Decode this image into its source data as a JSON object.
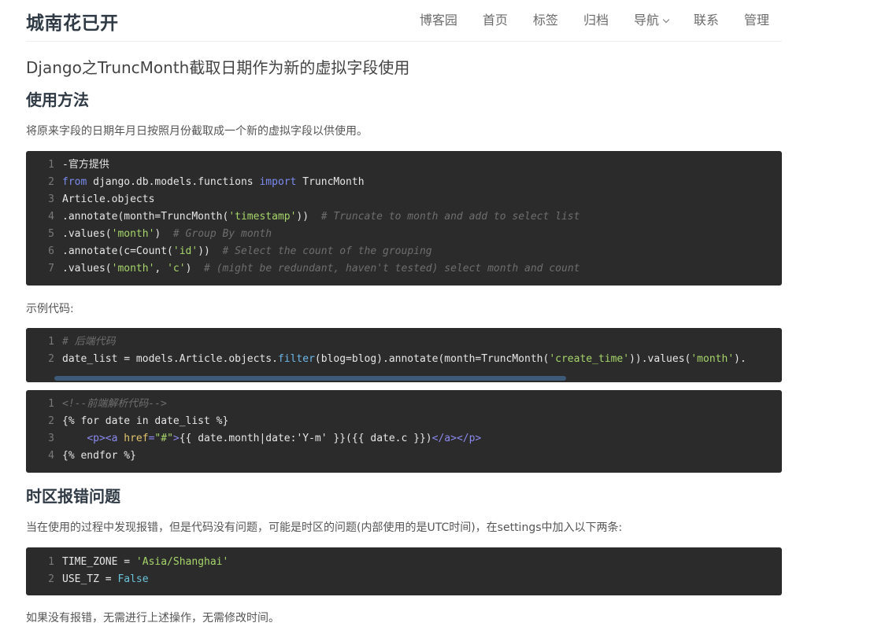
{
  "header": {
    "brand": "城南花已开",
    "nav": [
      {
        "label": "博客园"
      },
      {
        "label": "首页"
      },
      {
        "label": "标签"
      },
      {
        "label": "归档"
      },
      {
        "label": "导航"
      },
      {
        "label": "联系"
      },
      {
        "label": "管理"
      }
    ]
  },
  "article": {
    "title": "Django之TruncMonth截取日期作为新的虚拟字段使用",
    "section1_heading": "使用方法",
    "section1_text": "将原来字段的日期年月日按照月份截取成一个新的虚拟字段以供使用。",
    "example_label": "示例代码:",
    "section2_heading": "时区报错问题",
    "section2_text": "当在使用的过程中发现报错，但是代码没有问题，可能是时区的问题(内部使用的是UTC时间)，在settings中加入以下两条:",
    "footer_text": "如果没有报错，无需进行上述操作，无需修改时间。"
  },
  "code_blocks": {
    "block1": {
      "line_numbers": [
        "1",
        "2",
        "3",
        "4",
        "5",
        "6",
        "7"
      ],
      "lines": [
        "-官方提供",
        "from django.db.models.functions import TruncMonth",
        "Article.objects",
        ".annotate(month=TruncMonth('timestamp'))  # Truncate to month and add to select list",
        ".values('month')  # Group By month",
        ".annotate(c=Count('id'))  # Select the count of the grouping",
        ".values('month', 'c')  # (might be redundant, haven't tested) select month and count"
      ]
    },
    "block2": {
      "line_numbers": [
        "1",
        "2"
      ],
      "lines": [
        "# 后端代码",
        "date_list = models.Article.objects.filter(blog=blog).annotate(month=TruncMonth('create_time')).values('month')."
      ]
    },
    "block3": {
      "line_numbers": [
        "1",
        "2",
        "3",
        "4"
      ],
      "lines": [
        "<!--前端解析代码-->",
        "{% for date in date_list %}",
        "    <p><a href=\"#\">{{ date.month|date:'Y-m' }}({{ date.c }})</a></p>",
        "{% endfor %}"
      ]
    },
    "block4": {
      "line_numbers": [
        "1",
        "2"
      ],
      "lines": [
        "TIME_ZONE = 'Asia/Shanghai'",
        "USE_TZ = False"
      ]
    }
  }
}
